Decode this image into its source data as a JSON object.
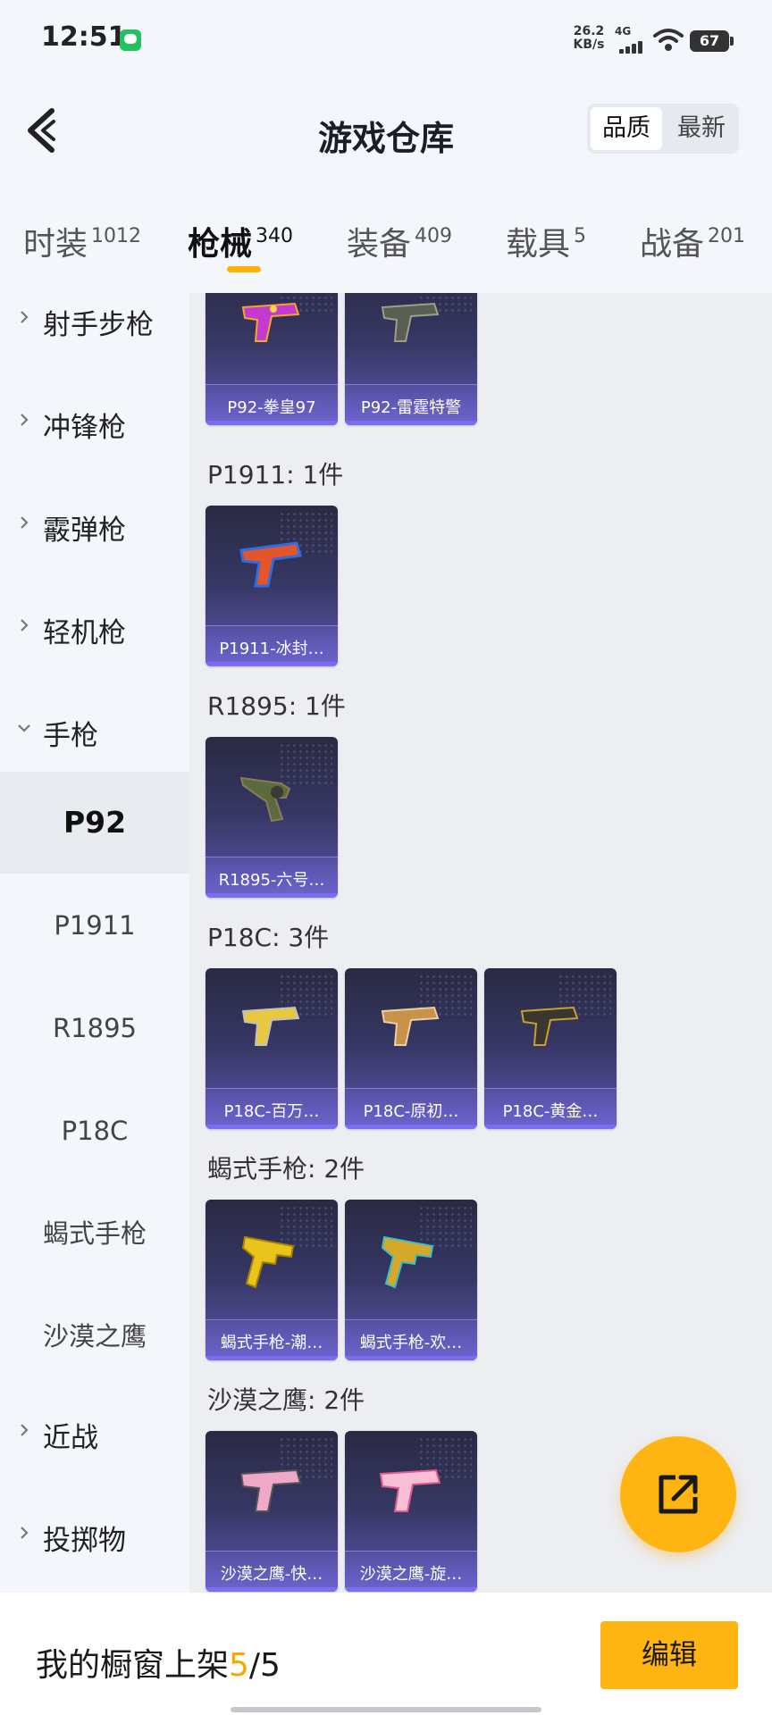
{
  "status_bar": {
    "time": "12:51",
    "net_speed_value": "26.2",
    "net_speed_unit": "KB/s",
    "network": "4G",
    "battery": "67"
  },
  "header": {
    "title": "游戏仓库",
    "sort_options": [
      "品质",
      "最新"
    ]
  },
  "category_tabs": [
    {
      "label": "时装",
      "count": "1012"
    },
    {
      "label": "枪械",
      "count": "340"
    },
    {
      "label": "装备",
      "count": "409"
    },
    {
      "label": "载具",
      "count": "5"
    },
    {
      "label": "战备",
      "count": "201"
    }
  ],
  "sidebar": {
    "groups": [
      "射手步枪",
      "冲锋枪",
      "霰弹枪",
      "轻机枪",
      "手枪",
      "近战",
      "投掷物"
    ],
    "pistol_subitems": [
      "P92",
      "P1911",
      "R1895",
      "P18C",
      "蝎式手枪",
      "沙漠之鹰"
    ]
  },
  "sections": [
    {
      "title": "",
      "items": [
        "P92-拳皇97",
        "P92-雷霆特警"
      ]
    },
    {
      "title": "P1911: 1件",
      "items": [
        "P1911-冰封…"
      ]
    },
    {
      "title": "R1895: 1件",
      "items": [
        "R1895-六号…"
      ]
    },
    {
      "title": "P18C: 3件",
      "items": [
        "P18C-百万…",
        "P18C-原初…",
        "P18C-黄金…"
      ]
    },
    {
      "title": "蝎式手枪: 2件",
      "items": [
        "蝎式手枪-潮…",
        "蝎式手枪-欢…"
      ]
    },
    {
      "title": "沙漠之鹰: 2件",
      "items": [
        "沙漠之鹰-快…",
        "沙漠之鹰-旋…"
      ]
    }
  ],
  "bottom_bar": {
    "shelf_label": "我的橱窗上架",
    "shelf_current": "5",
    "shelf_total": "/5",
    "edit_label": "编辑"
  },
  "colors": {
    "accent": "#ffb511",
    "card_top": "#2a2a44",
    "card_bottom": "#5d57b0"
  }
}
